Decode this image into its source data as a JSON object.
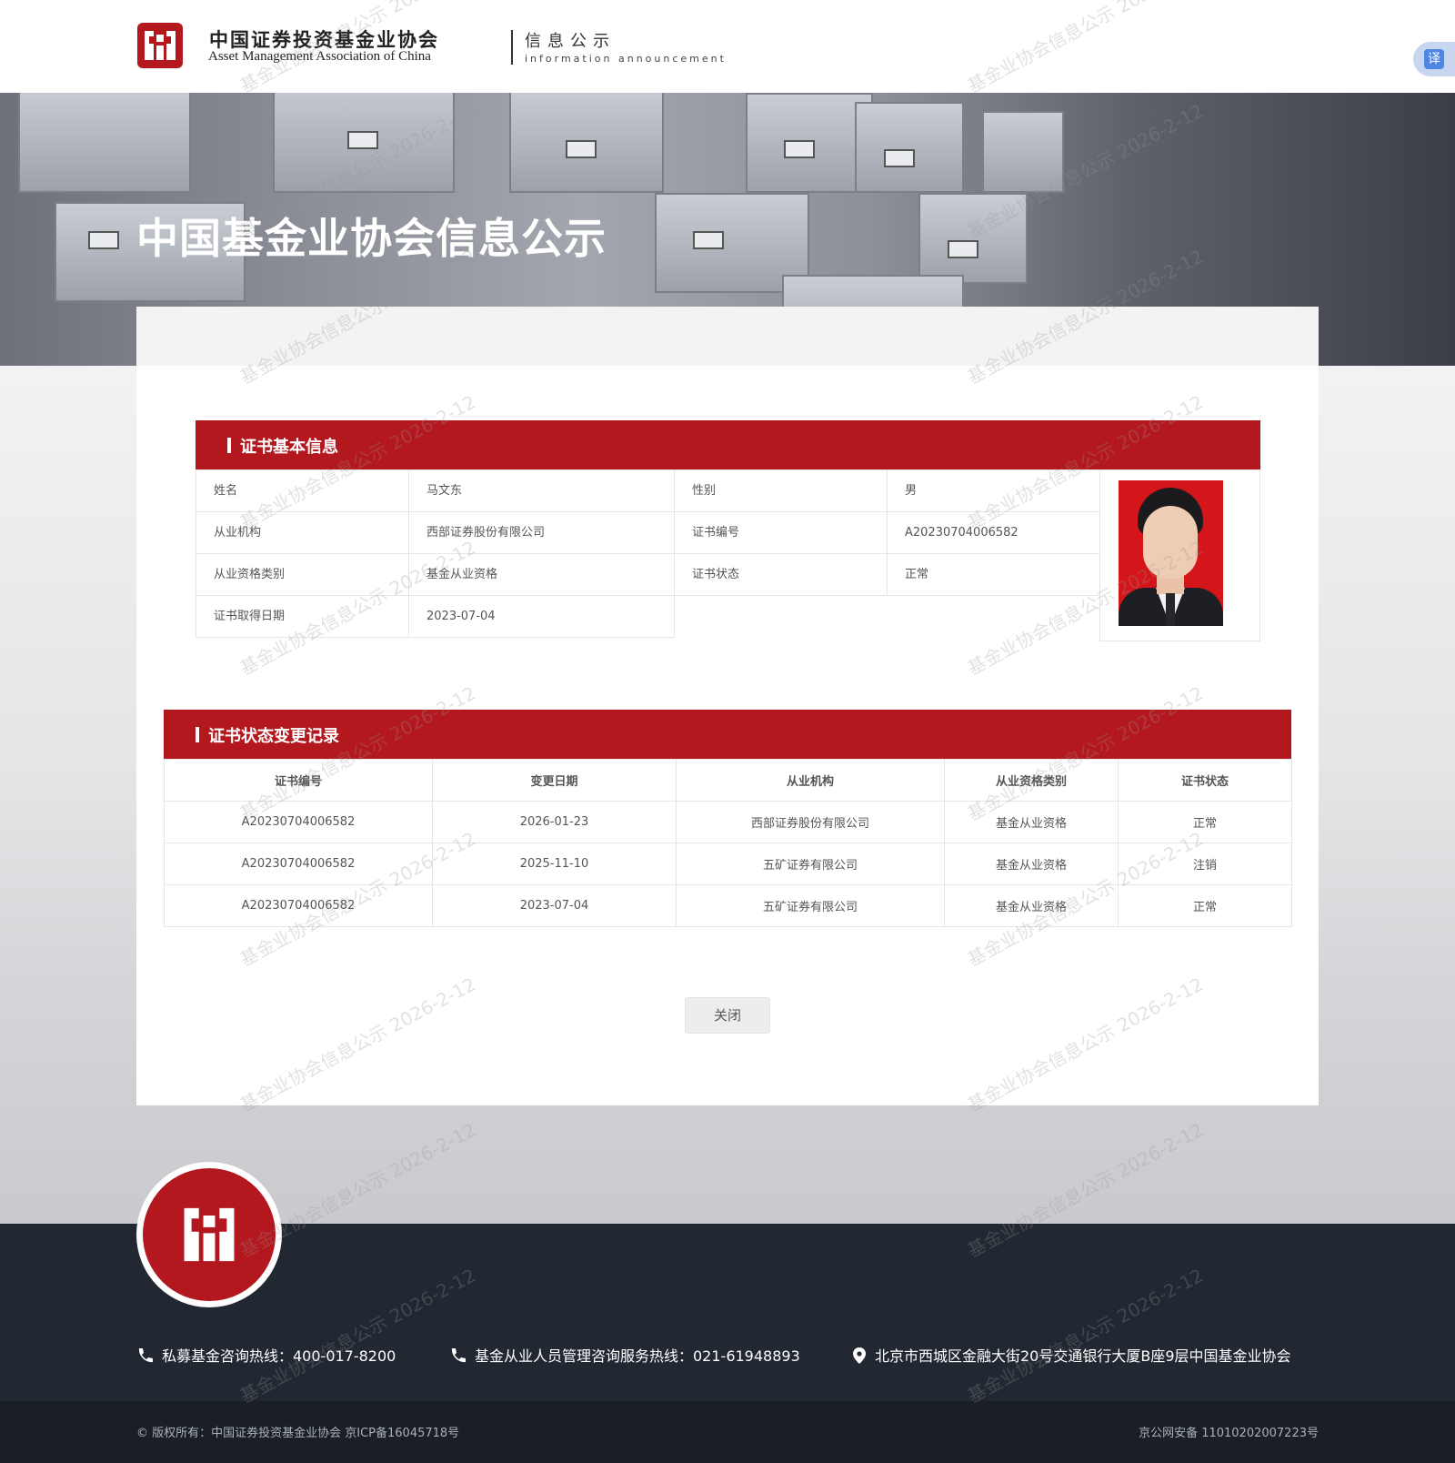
{
  "header": {
    "org_name_cn": "中国证券投资基金业协会",
    "org_name_en": "Asset Management Association of China",
    "section_cn": "信息公示",
    "section_en": "information announcement",
    "translate_label": "译"
  },
  "banner": {
    "title": "中国基金业协会信息公示"
  },
  "basic_info": {
    "section_title": "证书基本信息",
    "rows": [
      {
        "label1": "姓名",
        "value1": "马文东",
        "label2": "性别",
        "value2": "男"
      },
      {
        "label1": "从业机构",
        "value1": "西部证券股份有限公司",
        "label2": "证书编号",
        "value2": "A20230704006582"
      },
      {
        "label1": "从业资格类别",
        "value1": "基金从业资格",
        "label2": "证书状态",
        "value2": "正常"
      },
      {
        "label1": "证书取得日期",
        "value1": "2023-07-04"
      }
    ]
  },
  "records": {
    "section_title": "证书状态变更记录",
    "headers": [
      "证书编号",
      "变更日期",
      "从业机构",
      "从业资格类别",
      "证书状态"
    ],
    "rows": [
      [
        "A20230704006582",
        "2026-01-23",
        "西部证券股份有限公司",
        "基金从业资格",
        "正常"
      ],
      [
        "A20230704006582",
        "2025-11-10",
        "五矿证券有限公司",
        "基金从业资格",
        "注销"
      ],
      [
        "A20230704006582",
        "2023-07-04",
        "五矿证券有限公司",
        "基金从业资格",
        "正常"
      ]
    ]
  },
  "close_button": "关闭",
  "footer": {
    "hotline_private": "私募基金咨询热线：400-017-8200",
    "hotline_staff": "基金从业人员管理咨询服务热线：021-61948893",
    "address": "北京市西城区金融大街20号交通银行大厦B座9层中国基金业协会",
    "copyright": "© 版权所有：中国证券投资基金业协会 京ICP备16045718号",
    "police_record": "京公网安备 11010202007223号"
  },
  "watermark_text": "基金业协会信息公示 2026-2-12",
  "colors": {
    "brand_red": "#b3181e",
    "footer_dark": "#222832",
    "footer_bottom": "#1a1f27"
  },
  "icons": [
    "logo-seal-icon",
    "translate-icon",
    "phone-icon",
    "location-pin-icon"
  ]
}
